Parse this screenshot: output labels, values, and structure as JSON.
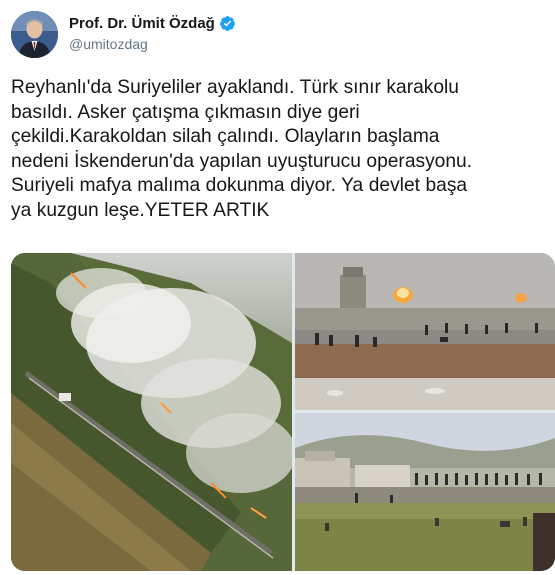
{
  "tweet": {
    "author": {
      "display_name": "Prof. Dr. Ümit Özdağ",
      "handle": "@umitozdag",
      "verified": true
    },
    "text": "Reyhanlı'da Suriyeliler ayaklandı. Türk sınır karakolu\nbasıldı. Asker çatışma çıkmasın diye geri\nçekildi.Karakoldan silah çalındı. Olayların başlama\nnedeni İskenderun'da yapılan uyuşturucu operasyonu.\nSuriyeli mafya malıma dokunma diyor. Ya devlet başa\nya kuzgun leşe.YETER ARTIK",
    "media_count": 3
  },
  "colors": {
    "verified_badge": "#1da1f2",
    "handle_gray": "#657786",
    "text": "#14171a"
  },
  "icons": {
    "verified": "verified-badge-icon"
  }
}
